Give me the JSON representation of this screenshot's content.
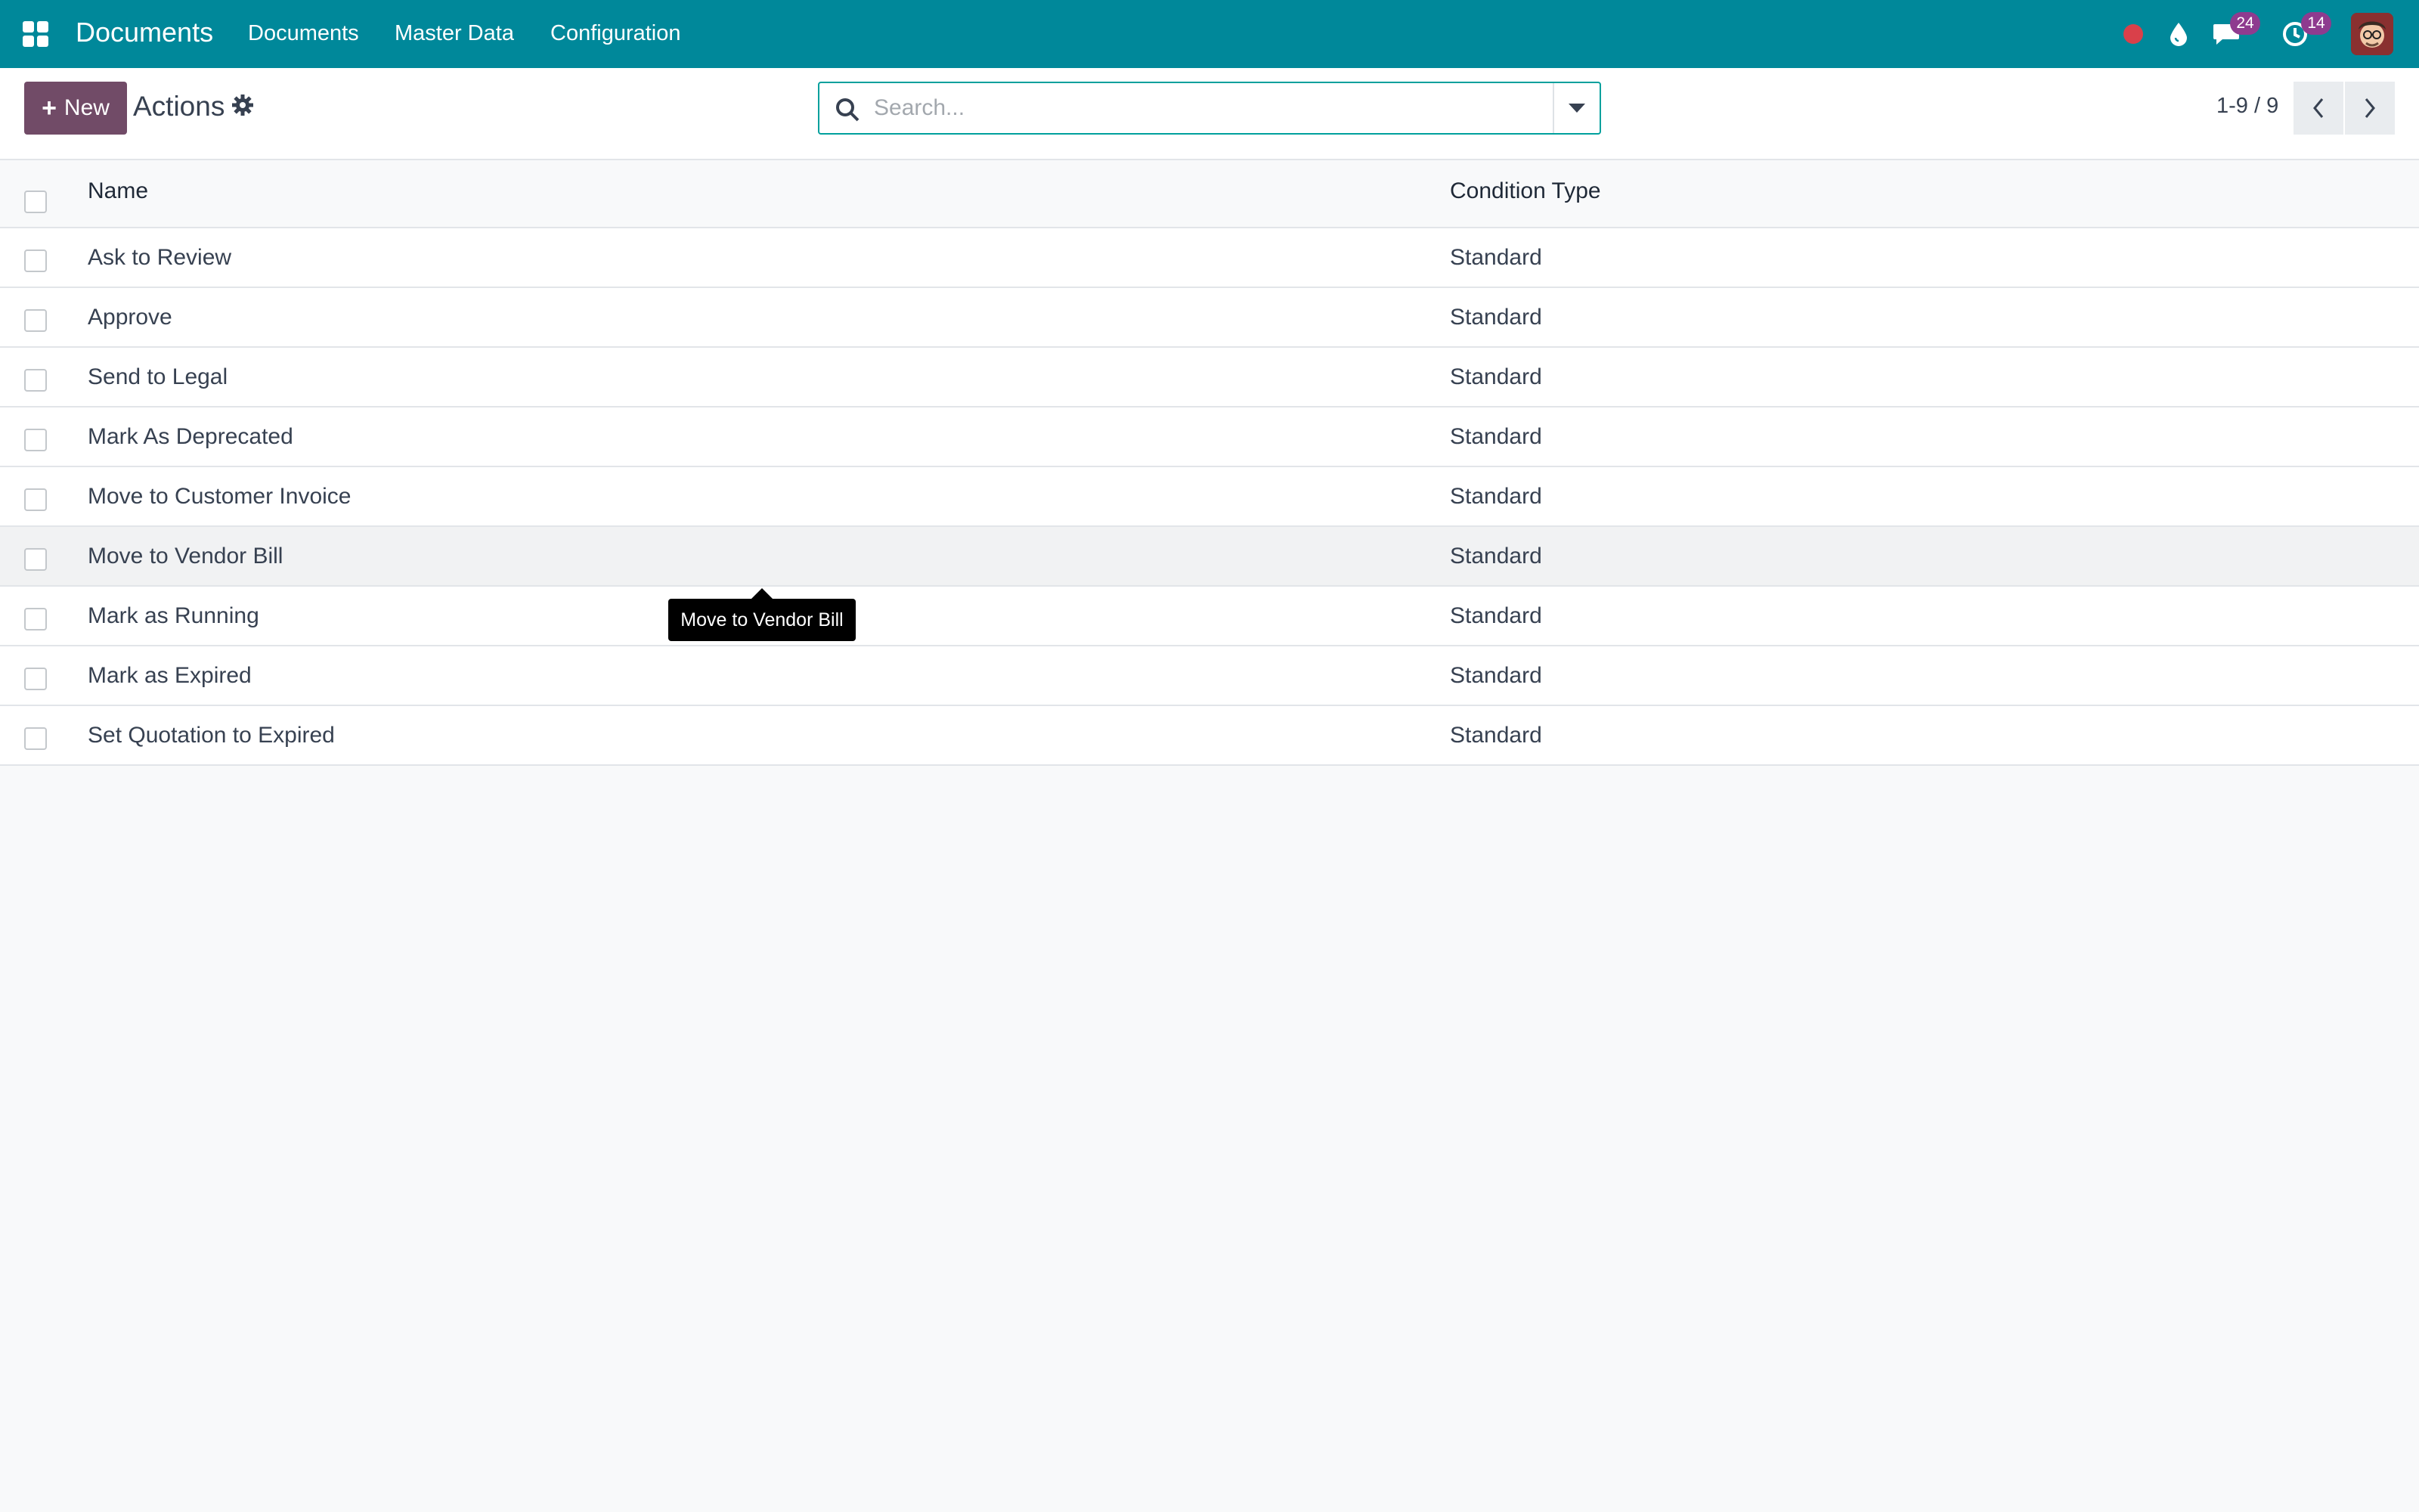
{
  "navbar": {
    "brand": "Documents",
    "menu": [
      "Documents",
      "Master Data",
      "Configuration"
    ],
    "messages_count": "24",
    "activities_count": "14",
    "icons": [
      "apps-grid-icon",
      "recording-dot-icon",
      "drop-icon",
      "chat-bubble-icon",
      "clock-icon",
      "avatar"
    ]
  },
  "control_panel": {
    "new_label": "New",
    "title": "Actions",
    "search_placeholder": "Search...",
    "pager": "1-9 / 9"
  },
  "list": {
    "columns": [
      "Name",
      "Condition Type"
    ],
    "rows": [
      {
        "name": "Ask to Review",
        "condition_type": "Standard"
      },
      {
        "name": "Approve",
        "condition_type": "Standard"
      },
      {
        "name": "Send to Legal",
        "condition_type": "Standard"
      },
      {
        "name": "Mark As Deprecated",
        "condition_type": "Standard"
      },
      {
        "name": "Move to Customer Invoice",
        "condition_type": "Standard"
      },
      {
        "name": "Move to Vendor Bill",
        "condition_type": "Standard"
      },
      {
        "name": "Mark as Running",
        "condition_type": "Standard"
      },
      {
        "name": "Mark as Expired",
        "condition_type": "Standard"
      },
      {
        "name": "Set Quotation to Expired",
        "condition_type": "Standard"
      }
    ]
  },
  "tooltip": "Move to Vendor Bill",
  "colors": {
    "navbar": "#00889a",
    "primary_button": "#714b67",
    "badge": "#8e3b8f",
    "search_border": "#00a09d"
  }
}
